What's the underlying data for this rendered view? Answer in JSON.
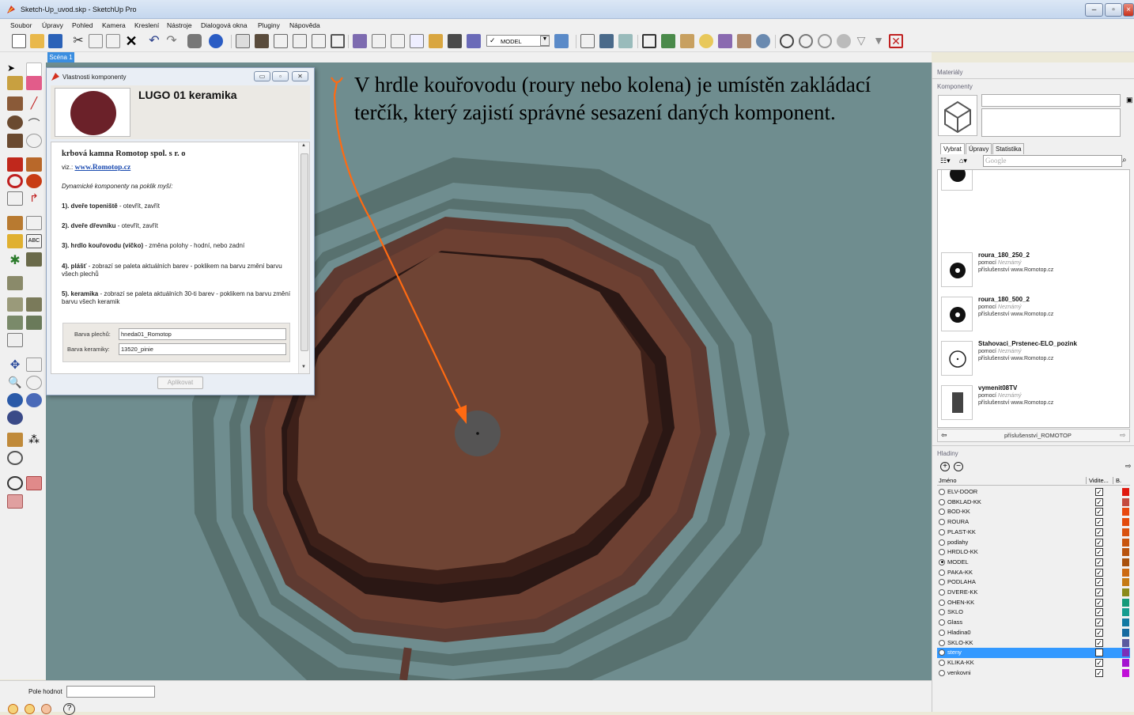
{
  "window": {
    "title": "Sketch-Up_uvod.skp - SketchUp Pro"
  },
  "menu": [
    "Soubor",
    "Úpravy",
    "Pohled",
    "Kamera",
    "Kreslení",
    "Nástroje",
    "Dialogová okna",
    "Pluginy",
    "Nápověda"
  ],
  "toolbar": {
    "layer_dropdown": "MODEL"
  },
  "scene_tab": "Scéna 1",
  "status": {
    "pole_label": "Pole hodnot"
  },
  "annotation": "V hrdle kouřovodu (roury nebo kolena) je umístěn zakládací terčík, který zajistí správné sesazení daných komponent.",
  "dialog": {
    "title": "Vlastnosti komponenty",
    "component_name": "LUGO 01 keramika",
    "maker": "krbová kamna Romotop spol. s r. o",
    "see_prefix": "viz.:",
    "see_link": "www.Romotop.cz",
    "dyn_note": "Dynamické komponenty na poklik myší:",
    "items": [
      {
        "b": "1). dveře topeniště",
        "rest": " - otevřít, zavřít"
      },
      {
        "b": "2). dveře dřevníku",
        "rest": " - otevřít, zavřít"
      },
      {
        "b": "3). hrdlo kouřovodu (víčko)",
        "rest": " - změna polohy - hodní, nebo zadní"
      },
      {
        "b": "4). plášť",
        "rest": " - zobrazí se paleta aktuálních barev - poklikem na barvu změní barvu všech plechů"
      },
      {
        "b": "5). keramika",
        "rest": " - zobrazí se paleta aktuálních 30-ti barev - poklikem na barvu změní barvu všech keramik"
      }
    ],
    "field1_label": "Barva plechů:",
    "field1_value": "hneda01_Romotop",
    "field2_label": "Barva keramiky:",
    "field2_value": "13520_pinie",
    "apply_label": "Aplikovat"
  },
  "right": {
    "materials_title": "Materiály",
    "components_title": "Komponenty",
    "tabs": [
      "Vybrat",
      "Úpravy",
      "Statistika"
    ],
    "search_placeholder": "Google",
    "components": [
      {
        "name": "roura_180_250_2",
        "by_label": "pomocí",
        "by": "Neznámý",
        "desc": "příslušenství www.Romotop.cz"
      },
      {
        "name": "roura_180_500_2",
        "by_label": "pomocí",
        "by": "Neznámý",
        "desc": "příslušenství www.Romotop.cz"
      },
      {
        "name": "Stahovaci_Prstenec-ELO_pozink",
        "by_label": "pomocí",
        "by": "Neznámý",
        "desc": "příslušenství www.Romotop.cz"
      },
      {
        "name": "vymenit08TV",
        "by_label": "pomocí",
        "by": "Neznámý",
        "desc": "příslušenství www.Romotop.cz"
      }
    ],
    "collection": "příslušenství_ROMOTOP",
    "layers_title": "Hladiny",
    "layers_headers": {
      "name": "Jméno",
      "visible": "Vidite...",
      "color": "B."
    },
    "layers": [
      {
        "name": "ELV-DOOR",
        "visible": true,
        "color": "#e0190f"
      },
      {
        "name": "OBKLAD-KK",
        "visible": true,
        "color": "#c44a3e"
      },
      {
        "name": "BOD-KK",
        "visible": true,
        "color": "#e8480f"
      },
      {
        "name": "ROURA",
        "visible": true,
        "color": "#e34b0d"
      },
      {
        "name": "PLAST-KK",
        "visible": true,
        "color": "#d9520f"
      },
      {
        "name": "podlahy",
        "visible": true,
        "color": "#c8550e"
      },
      {
        "name": "HRDLO-KK",
        "visible": true,
        "color": "#b8530e"
      },
      {
        "name": "MODEL",
        "visible": true,
        "color": "#a9510c",
        "active": true
      },
      {
        "name": "PAKA-KK",
        "visible": true,
        "color": "#cc6a12"
      },
      {
        "name": "PODLAHA",
        "visible": true,
        "color": "#c57a14"
      },
      {
        "name": "DVERE-KK",
        "visible": true,
        "color": "#8a8a1a"
      },
      {
        "name": "OHEN-KK",
        "visible": true,
        "color": "#169a7a"
      },
      {
        "name": "SKLO",
        "visible": true,
        "color": "#159c90"
      },
      {
        "name": "Glass",
        "visible": true,
        "color": "#1279a3"
      },
      {
        "name": "Hladina0",
        "visible": true,
        "color": "#166aa0"
      },
      {
        "name": "SKLO-KK",
        "visible": true,
        "color": "#5a5aa0"
      },
      {
        "name": "steny",
        "visible": false,
        "color": "#7a2fb8",
        "selected": true
      },
      {
        "name": "KLIKA-KK",
        "visible": true,
        "color": "#a515d0"
      },
      {
        "name": "venkovni",
        "visible": true,
        "color": "#c010d8"
      }
    ]
  }
}
